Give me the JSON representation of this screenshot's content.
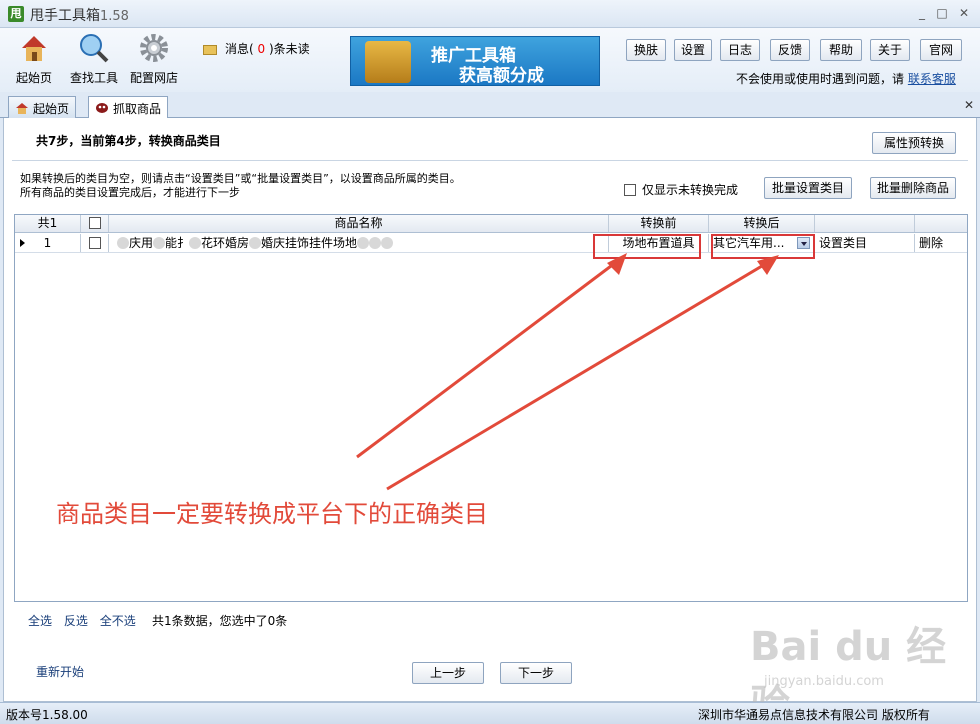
{
  "window": {
    "title": "甩手工具箱",
    "version": "1.58",
    "icon_char": "甩"
  },
  "toolbar": {
    "tools": [
      {
        "label": "起始页",
        "icon": "home-icon"
      },
      {
        "label": "查找工具",
        "icon": "magnifier-icon"
      },
      {
        "label": "配置网店",
        "icon": "gear-icon"
      }
    ],
    "msg_prefix": "消息(",
    "msg_count": "0",
    "msg_suffix": ")条未读",
    "banner_line1": "推广工具箱",
    "banner_line2": "获高额分成",
    "buttons": [
      "换肤",
      "设置",
      "日志",
      "反馈",
      "帮助",
      "关于",
      "官网"
    ],
    "help_text": "不会使用或使用时遇到问题，请",
    "help_link": "联系客服"
  },
  "tabs": [
    "起始页",
    "抓取商品"
  ],
  "page": {
    "step_title": "共7步，当前第4步，转换商品类目",
    "attr_button": "属性预转换",
    "note_line1": "如果转换后的类目为空，则请点击“设置类目”或“批量设置类目”，以设置商品所属的类目。",
    "note_line2": "所有商品的类目设置完成后，才能进行下一步",
    "only_unconverted": "仅显示未转换完成",
    "batch_set": "批量设置类目",
    "batch_delete": "批量删除商品"
  },
  "grid": {
    "headers": {
      "count": "共1",
      "name": "商品名称",
      "before": "转换前",
      "after": "转换后"
    },
    "rows": [
      {
        "index": "1",
        "name_parts": [
          "",
          "庆用",
          "",
          "能扌",
          "",
          "花环婚房",
          "",
          "婚庆挂饰挂件场地",
          "",
          "",
          ""
        ],
        "before": "场地布置道具",
        "after": "其它汽车用...",
        "set_category": "设置类目",
        "delete": "删除"
      }
    ]
  },
  "footer": {
    "select_all": "全选",
    "invert": "反选",
    "select_none": "全不选",
    "info": "共1条数据，您选中了0条",
    "restart": "重新开始",
    "prev": "上一步",
    "next": "下一步"
  },
  "annotation": "商品类目一定要转换成平台下的正确类目",
  "status": {
    "version": "版本号1.58.00",
    "company": "深圳市华通易点信息技术有限公司  版权所有"
  },
  "watermark": {
    "brand": "Bai du 经验",
    "url": "jingyan.baidu.com"
  },
  "colors": {
    "annotation": "#e24a3a",
    "highlight_box": "#d93838",
    "banner": "#1b78c4"
  }
}
